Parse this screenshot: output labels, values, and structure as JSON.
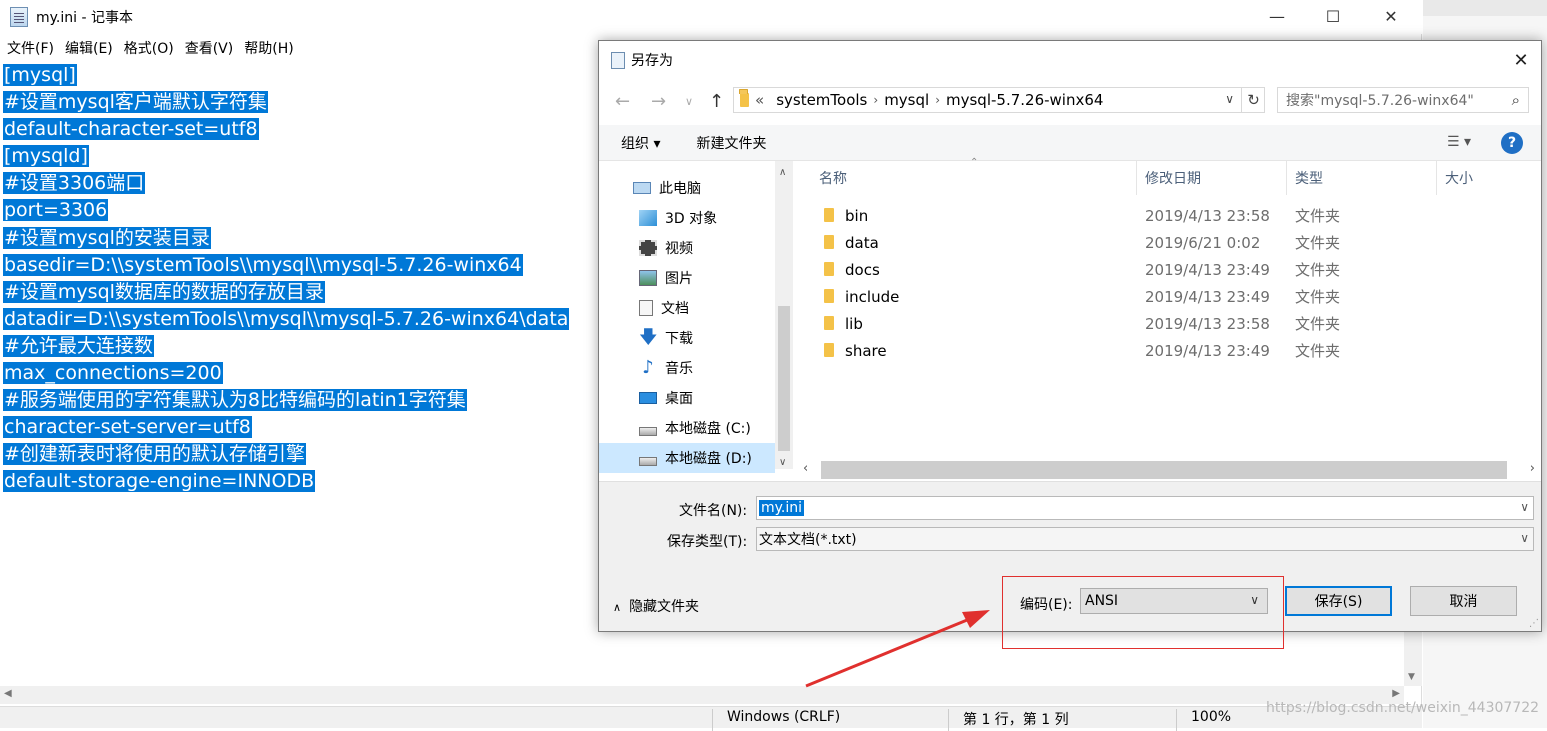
{
  "notepad": {
    "title": "my.ini - 记事本",
    "menu": [
      "文件(F)",
      "编辑(E)",
      "格式(O)",
      "查看(V)",
      "帮助(H)"
    ],
    "lines": [
      "[mysql]",
      "#设置mysql客户端默认字符集",
      "default-character-set=utf8",
      "[mysqld]",
      "#设置3306端口",
      "port=3306",
      "#设置mysql的安装目录",
      "basedir=D:\\\\systemTools\\\\mysql\\\\mysql-5.7.26-winx64",
      "#设置mysql数据库的数据的存放目录",
      "datadir=D:\\\\systemTools\\\\mysql\\\\mysql-5.7.26-winx64\\data",
      "#允许最大连接数",
      "max_connections=200",
      "#服务端使用的字符集默认为8比特编码的latin1字符集",
      "character-set-server=utf8",
      "#创建新表时将使用的默认存储引擎",
      "default-storage-engine=INNODB"
    ],
    "status": {
      "encoding": "Windows (CRLF)",
      "position": "第 1 行，第 1 列",
      "zoom": "100%"
    }
  },
  "dialog": {
    "title": "另存为",
    "address": {
      "prefix": "«",
      "crumbs": [
        "systemTools",
        "mysql",
        "mysql-5.7.26-winx64"
      ]
    },
    "search_placeholder": "搜索\"mysql-5.7.26-winx64\"",
    "toolbar": {
      "organize": "组织 ▾",
      "new_folder": "新建文件夹"
    },
    "nav": [
      {
        "label": "此电脑",
        "icon": "computer-icon"
      },
      {
        "label": "3D 对象",
        "icon": "3d-objects-icon"
      },
      {
        "label": "视频",
        "icon": "video-icon"
      },
      {
        "label": "图片",
        "icon": "pictures-icon"
      },
      {
        "label": "文档",
        "icon": "documents-icon"
      },
      {
        "label": "下载",
        "icon": "download-icon"
      },
      {
        "label": "音乐",
        "icon": "music-icon"
      },
      {
        "label": "桌面",
        "icon": "desktop-icon"
      },
      {
        "label": "本地磁盘 (C:)",
        "icon": "drive-icon"
      },
      {
        "label": "本地磁盘 (D:)",
        "icon": "drive-icon",
        "selected": true
      }
    ],
    "columns": [
      "名称",
      "修改日期",
      "类型",
      "大小"
    ],
    "files": [
      {
        "name": "bin",
        "date": "2019/4/13 23:58",
        "type": "文件夹"
      },
      {
        "name": "data",
        "date": "2019/6/21 0:02",
        "type": "文件夹"
      },
      {
        "name": "docs",
        "date": "2019/4/13 23:49",
        "type": "文件夹"
      },
      {
        "name": "include",
        "date": "2019/4/13 23:49",
        "type": "文件夹"
      },
      {
        "name": "lib",
        "date": "2019/4/13 23:58",
        "type": "文件夹"
      },
      {
        "name": "share",
        "date": "2019/4/13 23:49",
        "type": "文件夹"
      }
    ],
    "filename_label": "文件名(N):",
    "filename_value": "my.ini",
    "filetype_label": "保存类型(T):",
    "filetype_value": "文本文档(*.txt)",
    "hide_folders": "隐藏文件夹",
    "encoding_label": "编码(E):",
    "encoding_value": "ANSI",
    "save_button": "保存(S)",
    "cancel_button": "取消"
  },
  "watermark": "https://blog.csdn.net/weixin_44307722",
  "colors": {
    "selection": "#0078d7",
    "annotation": "#e0302e",
    "nav_selected": "#cce8ff"
  }
}
